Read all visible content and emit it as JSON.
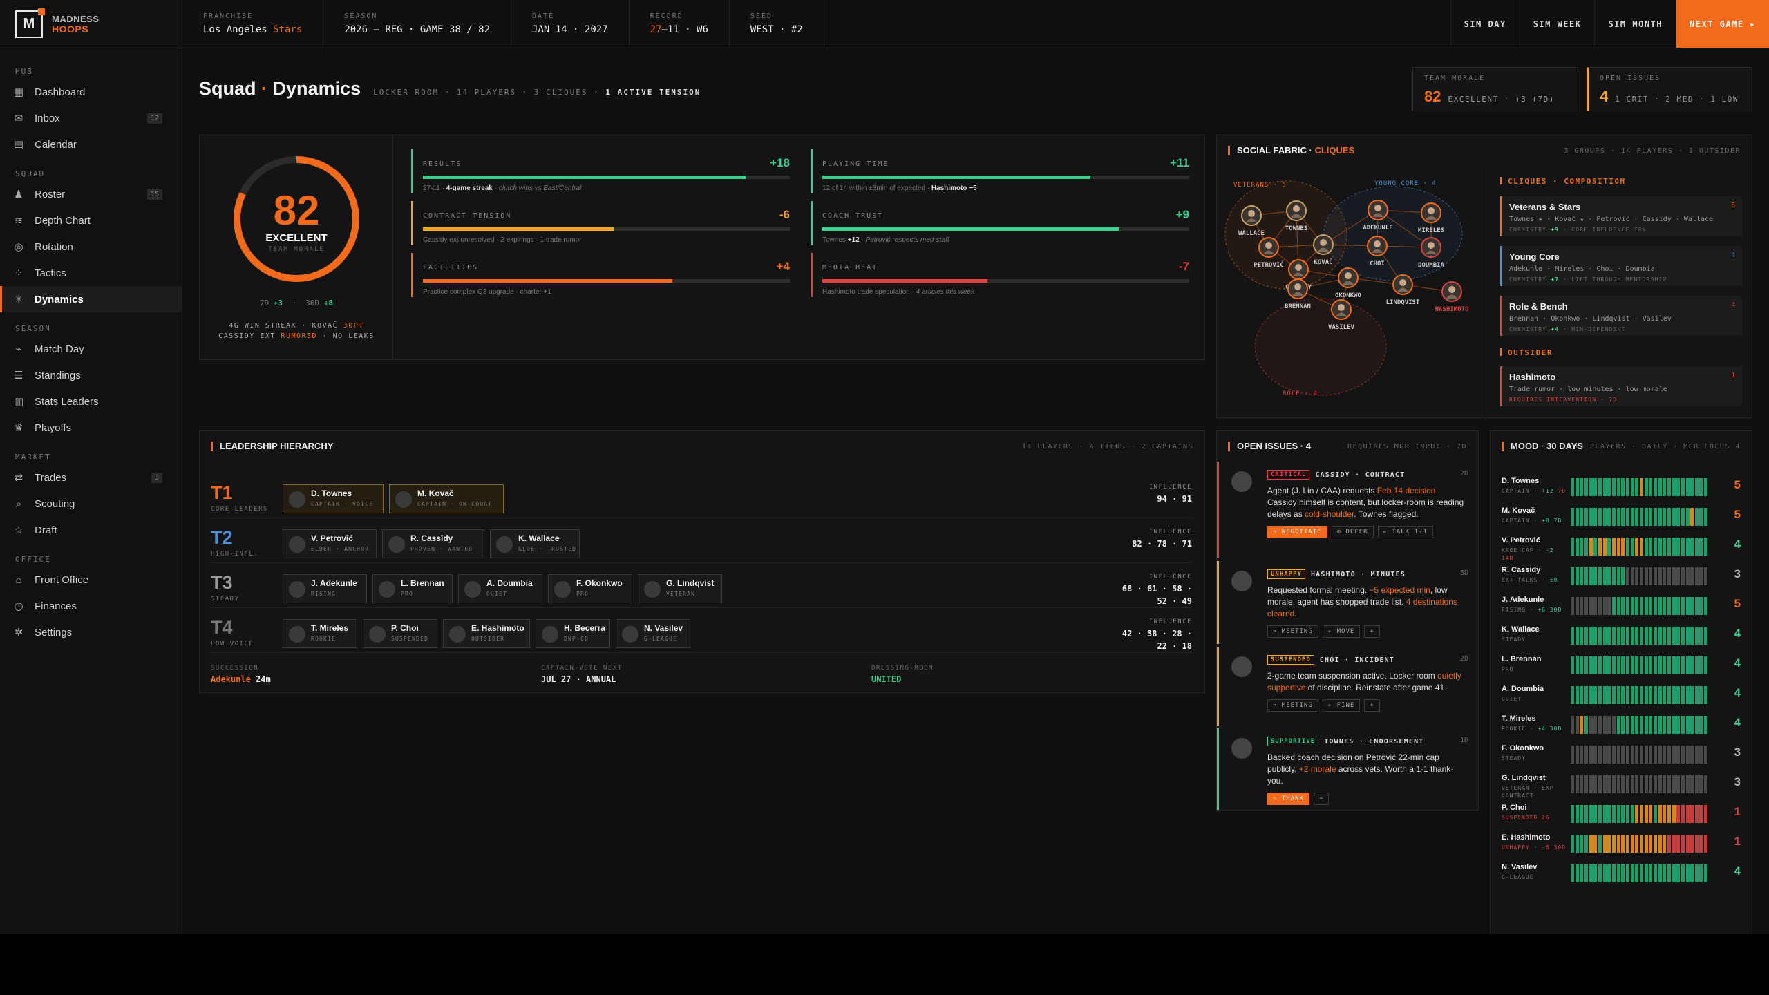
{
  "app": {
    "name_line1": "MADNESS",
    "name_line2": "HOOPS",
    "logo_letter": "M"
  },
  "topbar": {
    "stats": [
      {
        "key": "FRANCHISE",
        "pre": "Los Angeles ",
        "hl": "Stars",
        "post": ""
      },
      {
        "key": "SEASON",
        "pre": "2026 — REG · GAME 38 / 82",
        "hl": "",
        "post": ""
      },
      {
        "key": "DATE",
        "pre": "JAN 14 · 2027",
        "hl": "",
        "post": ""
      },
      {
        "key": "RECORD",
        "pre": "",
        "hl": "27",
        "post": "–11 · W6"
      },
      {
        "key": "SEED",
        "pre": "WEST · #2",
        "hl": "",
        "post": ""
      }
    ],
    "buttons": [
      "SIM DAY",
      "SIM WEEK",
      "SIM MONTH"
    ],
    "next_button": "NEXT GAME ▸"
  },
  "sidebar": {
    "sections": [
      {
        "label": "HUB",
        "items": [
          {
            "label": "Dashboard",
            "icon": "grid-icon",
            "badge": ""
          },
          {
            "label": "Inbox",
            "icon": "mail-icon",
            "badge": "12"
          },
          {
            "label": "Calendar",
            "icon": "calendar-icon",
            "badge": ""
          }
        ]
      },
      {
        "label": "SQUAD",
        "items": [
          {
            "label": "Roster",
            "icon": "user-icon",
            "badge": "15"
          },
          {
            "label": "Depth Chart",
            "icon": "layers-icon",
            "badge": ""
          },
          {
            "label": "Rotation",
            "icon": "rotation-icon",
            "badge": ""
          },
          {
            "label": "Tactics",
            "icon": "tactics-icon",
            "badge": ""
          },
          {
            "label": "Dynamics",
            "icon": "dynamics-icon",
            "badge": "",
            "active": true
          }
        ]
      },
      {
        "label": "SEASON",
        "items": [
          {
            "label": "Match Day",
            "icon": "pulse-icon",
            "badge": ""
          },
          {
            "label": "Standings",
            "icon": "list-icon",
            "badge": ""
          },
          {
            "label": "Stats Leaders",
            "icon": "bar-chart-icon",
            "badge": ""
          },
          {
            "label": "Playoffs",
            "icon": "trophy-icon",
            "badge": ""
          }
        ]
      },
      {
        "label": "MARKET",
        "items": [
          {
            "label": "Trades",
            "icon": "swap-icon",
            "badge": "3"
          },
          {
            "label": "Scouting",
            "icon": "search-icon",
            "badge": ""
          },
          {
            "label": "Draft",
            "icon": "star-icon",
            "badge": ""
          }
        ]
      },
      {
        "label": "OFFICE",
        "items": [
          {
            "label": "Front Office",
            "icon": "building-icon",
            "badge": ""
          },
          {
            "label": "Finances",
            "icon": "coin-icon",
            "badge": ""
          },
          {
            "label": "Settings",
            "icon": "gear-icon",
            "badge": ""
          }
        ]
      }
    ]
  },
  "page": {
    "title_a": "Squad",
    "title_b": "Dynamics",
    "meta": "LOCKER ROOM · 14 PLAYERS · 3 CLIQUES · ",
    "meta_bold": "1 ACTIVE TENSION"
  },
  "kpis": {
    "team_morale": {
      "key": "TEAM MORALE",
      "value": "82",
      "sub": "EXCELLENT · +3 (7D)"
    },
    "open_issues": {
      "key": "OPEN ISSUES",
      "value": "4",
      "sub": "1 CRIT · 2 MED · 1 LOW"
    }
  },
  "morale": {
    "value": "82",
    "level": 0.82,
    "label": "EXCELLENT",
    "sub": "TEAM MORALE",
    "d7_label": "7D",
    "d7": "+3",
    "d30_label": "30D",
    "d30": "+8",
    "status1_pre": "4G WIN STREAK · KOVAČ ",
    "status1_hl": "30PT",
    "status2_pre": "CASSIDY EXT ",
    "status2_hl": "RUMORED",
    "status2_post": " · NO LEAKS",
    "factors": [
      {
        "key": "RESULTS",
        "delta": "+18",
        "level": 0.88,
        "color": "#3ecf8e",
        "note_a": "27-11 · ",
        "note_b": "4-game streak",
        "note_c": " · clutch wins vs East/Central"
      },
      {
        "key": "PLAYING TIME",
        "delta": "+11",
        "level": 0.73,
        "color": "#3ecf8e",
        "note_a": "12 of 14 within ±3min of expected · ",
        "note_b": "Hashimoto −5",
        "note_c": ""
      },
      {
        "key": "CONTRACT TENSION",
        "delta": "-6",
        "level": 0.52,
        "color": "#f5a623",
        "note_a": "Cassidy ext unresolved · 2 expirings · 1 trade rumor",
        "note_b": "",
        "note_c": ""
      },
      {
        "key": "COACH TRUST",
        "delta": "+9",
        "level": 0.81,
        "color": "#3ecf8e",
        "note_a": "Townes ",
        "note_b": "+12",
        "note_c": " · Petrović respects med-staff"
      },
      {
        "key": "FACILITIES",
        "delta": "+4",
        "level": 0.68,
        "color": "#f26a1b",
        "note_a": "Practice complex Q3 upgrade · charter +1",
        "note_b": "",
        "note_c": ""
      },
      {
        "key": "MEDIA HEAT",
        "delta": "-7",
        "level": 0.45,
        "color": "#e04040",
        "note_a": "Hashimoto trade speculation · ",
        "note_b": "",
        "note_c": "4 articles this week"
      }
    ]
  },
  "social": {
    "title_a": "SOCIAL FABRIC · ",
    "title_b": "CLIQUES",
    "meta": "3 GROUPS · 14 PLAYERS · 1 OUTSIDER",
    "group_labels": [
      "VETERANS · 5",
      "YOUNG CORE · 4",
      "ROLE · 4"
    ],
    "nodes": [
      "WALLACE",
      "TOWNES",
      "PETROVIĆ",
      "KOVAČ",
      "CASSIDY",
      "ADEKUNLE",
      "MIRELES",
      "CHOI",
      "DOUMBIA",
      "OKONKWO",
      "BRENNAN",
      "LINDQVIST",
      "VASILEV",
      "HASHIMOTO"
    ],
    "comp_header": "CLIQUES · COMPOSITION",
    "outsider_header": "OUTSIDER",
    "cliques": [
      {
        "name": "Veterans & Stars",
        "count": "5",
        "members": "Townes ★ · Kovač ★ · Petrović · Cassidy · Wallace",
        "chem_a": "CHEMISTRY ",
        "chem_b": "+9",
        "chem_c": " · CORE INFLUENCE 78%",
        "color": "#f26a1b"
      },
      {
        "name": "Young Core",
        "count": "4",
        "members": "Adekunle · Mireles · Choi · Doumbia",
        "chem_a": "CHEMISTRY ",
        "chem_b": "+7",
        "chem_c": " · LIFT THROUGH MENTORSHIP",
        "color": "#4a90e2"
      },
      {
        "name": "Role & Bench",
        "count": "4",
        "members": "Brennan · Okonkwo · Lindqvist · Vasilev",
        "chem_a": "CHEMISTRY ",
        "chem_b": "+4",
        "chem_c": " · MIN-DEPENDENT",
        "color": "#e04040"
      }
    ],
    "outsider": {
      "name": "Hashimoto",
      "count": "1",
      "members": "Trade rumor · low minutes · low morale",
      "note": "REQUIRES INTERVENTION · 7D"
    }
  },
  "leadership": {
    "title": "LEADERSHIP HIERARCHY",
    "meta": "14 PLAYERS · 4 TIERS · 2 CAPTAINS",
    "infl_label": "INFLUENCE",
    "tiers": [
      {
        "tier": "T1",
        "label": "CORE LEADERS",
        "color": "#f26a1b",
        "influence": "94 · 91",
        "players": [
          {
            "name": "D. Townes",
            "role": "CAPTAIN · VOICE",
            "gold": true
          },
          {
            "name": "M. Kovač",
            "role": "CAPTAIN · ON-COURT",
            "gold": true
          }
        ]
      },
      {
        "tier": "T2",
        "label": "HIGH-INFL.",
        "color": "#4a90e2",
        "influence": "82 · 78 · 71",
        "players": [
          {
            "name": "V. Petrović",
            "role": "ELDER · ANCHOR"
          },
          {
            "name": "R. Cassidy",
            "role": "PROVEN · WANTED"
          },
          {
            "name": "K. Wallace",
            "role": "GLUE · TRUSTED"
          }
        ]
      },
      {
        "tier": "T3",
        "label": "STEADY",
        "color": "#9a9a9a",
        "influence": "68 · 61 · 58 · 52 · 49",
        "players": [
          {
            "name": "J. Adekunle",
            "role": "RISING"
          },
          {
            "name": "L. Brennan",
            "role": "PRO"
          },
          {
            "name": "A. Doumbia",
            "role": "QUIET"
          },
          {
            "name": "F. Okonkwo",
            "role": "PRO"
          },
          {
            "name": "G. Lindqvist",
            "role": "VETERAN"
          }
        ]
      },
      {
        "tier": "T4",
        "label": "LOW VOICE",
        "color": "#777777",
        "influence": "42 · 38 · 28 · 22 · 18",
        "players": [
          {
            "name": "T. Mireles",
            "role": "ROOKIE"
          },
          {
            "name": "P. Choi",
            "role": "SUSPENDED"
          },
          {
            "name": "E. Hashimoto",
            "role": "OUTSIDER"
          },
          {
            "name": "H. Becerra",
            "role": "DNP-CD"
          },
          {
            "name": "N. Vasilev",
            "role": "G-LEAGUE"
          }
        ]
      }
    ],
    "footer": [
      {
        "key": "SUCCESSION",
        "hl": "Adekunle",
        "val": " 24m",
        "color": "#f26a1b"
      },
      {
        "key": "CAPTAIN-VOTE NEXT",
        "hl": "",
        "val": "JUL 27 · ANNUAL",
        "color": "#eee"
      },
      {
        "key": "DRESSING-ROOM",
        "hl": "UNITED",
        "val": "",
        "color": "#3ecf8e"
      }
    ]
  },
  "issues": {
    "title": "OPEN ISSUES · 4",
    "meta": "REQUIRES MGR INPUT · 7D",
    "items": [
      {
        "tag": "CRITICAL",
        "head": "CASSIDY · CONTRACT",
        "time": "2D",
        "color": "#e04040",
        "parts": [
          [
            "Agent (J. Lin / CAA) requests ",
            ""
          ],
          [
            "Feb 14 decision",
            "or"
          ],
          [
            ". Cassidy himself is content, but locker-room is reading delays as ",
            ""
          ],
          [
            "cold-shoulder",
            "or"
          ],
          [
            ". Townes flagged.",
            ""
          ]
        ],
        "actions": [
          {
            "label": "↝ NEGOTIATE",
            "pri": true
          },
          {
            "label": "⊙ DEFER",
            "pri": false
          },
          {
            "label": "▹ TALK 1-1",
            "pri": false
          }
        ]
      },
      {
        "tag": "UNHAPPY",
        "head": "HASHIMOTO · MINUTES",
        "time": "5D",
        "color": "#f5a623",
        "parts": [
          [
            "Requested formal meeting. ",
            ""
          ],
          [
            "−5 expected min",
            "or"
          ],
          [
            ", low morale, agent has shopped trade list. ",
            ""
          ],
          [
            "4 destinations cleared",
            "or"
          ],
          [
            ".",
            ""
          ]
        ],
        "actions": [
          {
            "label": "↝ MEETING",
            "pri": false
          },
          {
            "label": "▹ MOVE",
            "pri": false
          },
          {
            "label": "+",
            "pri": false
          }
        ]
      },
      {
        "tag": "SUSPENDED",
        "head": "CHOI · INCIDENT",
        "time": "2D",
        "color": "#f5a623",
        "parts": [
          [
            "2-game team suspension active. Locker room ",
            ""
          ],
          [
            "quietly supportive",
            "or"
          ],
          [
            " of discipline. Reinstate after game 41.",
            ""
          ]
        ],
        "actions": [
          {
            "label": "↝ MEETING",
            "pri": false
          },
          {
            "label": "▹ FINE",
            "pri": false
          },
          {
            "label": "+",
            "pri": false
          }
        ]
      },
      {
        "tag": "SUPPORTIVE",
        "head": "TOWNES · ENDORSEMENT",
        "time": "1D",
        "color": "#3ecf8e",
        "parts": [
          [
            "Backed coach decision on Petrović 22-min cap publicly. ",
            ""
          ],
          [
            "+2 morale",
            "or"
          ],
          [
            " across vets. Worth a 1-1 thank-you.",
            ""
          ]
        ],
        "actions": [
          {
            "label": "▹ THANK",
            "pri": true
          },
          {
            "label": "+",
            "pri": false
          }
        ]
      }
    ]
  },
  "mood": {
    "title": "MOOD · 30 DAYS",
    "meta": "14 PLAYERS · DAILY · MGR FOCUS 4",
    "players": [
      {
        "name": "D. Townes",
        "sub_a": "CAPTAIN · ",
        "sub_b": "+12",
        "sub_c": " 7D",
        "score": "5",
        "cells": "gggggggggggggggoggggggggggggggg"
      },
      {
        "name": "M. Kovač",
        "sub_a": "CAPTAIN · ",
        "sub_b": "+8 7D",
        "sub_c": "",
        "score": "5",
        "cells": "ggggggggggggggggggggggggggoggg"
      },
      {
        "name": "V. Petrović",
        "sub_a": "KNEE CAP · ",
        "sub_b": "-2",
        "sub_c": " 14D",
        "score": "4",
        "cells": "ggggogoogoooggoogggggggggggggg"
      },
      {
        "name": "R. Cassidy",
        "sub_a": "EXT TALKS · ",
        "sub_b": "±0",
        "sub_c": "",
        "score": "3",
        "cells": "ggggggggggggnnnnnnnnnnnnnnnnnn"
      },
      {
        "name": "J. Adekunle",
        "sub_a": "RISING · ",
        "sub_b": "+6 30D",
        "sub_c": "",
        "score": "5",
        "cells": "nnnnnnnnngggggggggggggggggggg"
      },
      {
        "name": "K. Wallace",
        "sub_a": "STEADY",
        "sub_b": "",
        "sub_c": "",
        "score": "4",
        "cells": "gggggggggggggggggggggggggggggg"
      },
      {
        "name": "L. Brennan",
        "sub_a": "PRO",
        "sub_b": "",
        "sub_c": "",
        "score": "4",
        "cells": "gggggggggggggggggggggggggggggg"
      },
      {
        "name": "A. Doumbia",
        "sub_a": "QUIET",
        "sub_b": "",
        "sub_c": "",
        "score": "4",
        "cells": "gggggggggggggggggggggggggggggg"
      },
      {
        "name": "T. Mireles",
        "sub_a": "ROOKIE · ",
        "sub_b": "+4 30D",
        "sub_c": "",
        "score": "4",
        "cells": "nnognnnnnngggggggggggggggggggg"
      },
      {
        "name": "F. Okonkwo",
        "sub_a": "STEADY",
        "sub_b": "",
        "sub_c": "",
        "score": "3",
        "cells": "nnnnnnnnnnnnnnnnnnnnnnnnnnnnnn"
      },
      {
        "name": "G. Lindqvist",
        "sub_a": "VETERAN · EXP CONTRACT",
        "sub_b": "",
        "sub_c": "",
        "score": "3",
        "cells": "nnnnnnnnnnnnnnnnnnnnnnnnnnnnnn"
      },
      {
        "name": "P. Choi",
        "sub_a": "",
        "sub_b": "",
        "sub_c": "SUSPENDED 2G",
        "score": "1",
        "cells": "ggggggggggggggoooogoooorrrrrrr"
      },
      {
        "name": "E. Hashimoto",
        "sub_a": "",
        "sub_b": "",
        "sub_c": "UNHAPPY · -8 30D",
        "score": "1",
        "cells": "ggggoogoooooooooooooorrrrrrrrr"
      },
      {
        "name": "N. Vasilev",
        "sub_a": "G-LEAGUE",
        "sub_b": "",
        "sub_c": "",
        "score": "4",
        "cells": "gggggggggggggggggggggggggggggg"
      }
    ]
  },
  "colors": {
    "accent": "#f26a1b",
    "good": "#3ecf8e",
    "warn": "#f5a623",
    "bad": "#e04040",
    "blue": "#4a90e2"
  }
}
